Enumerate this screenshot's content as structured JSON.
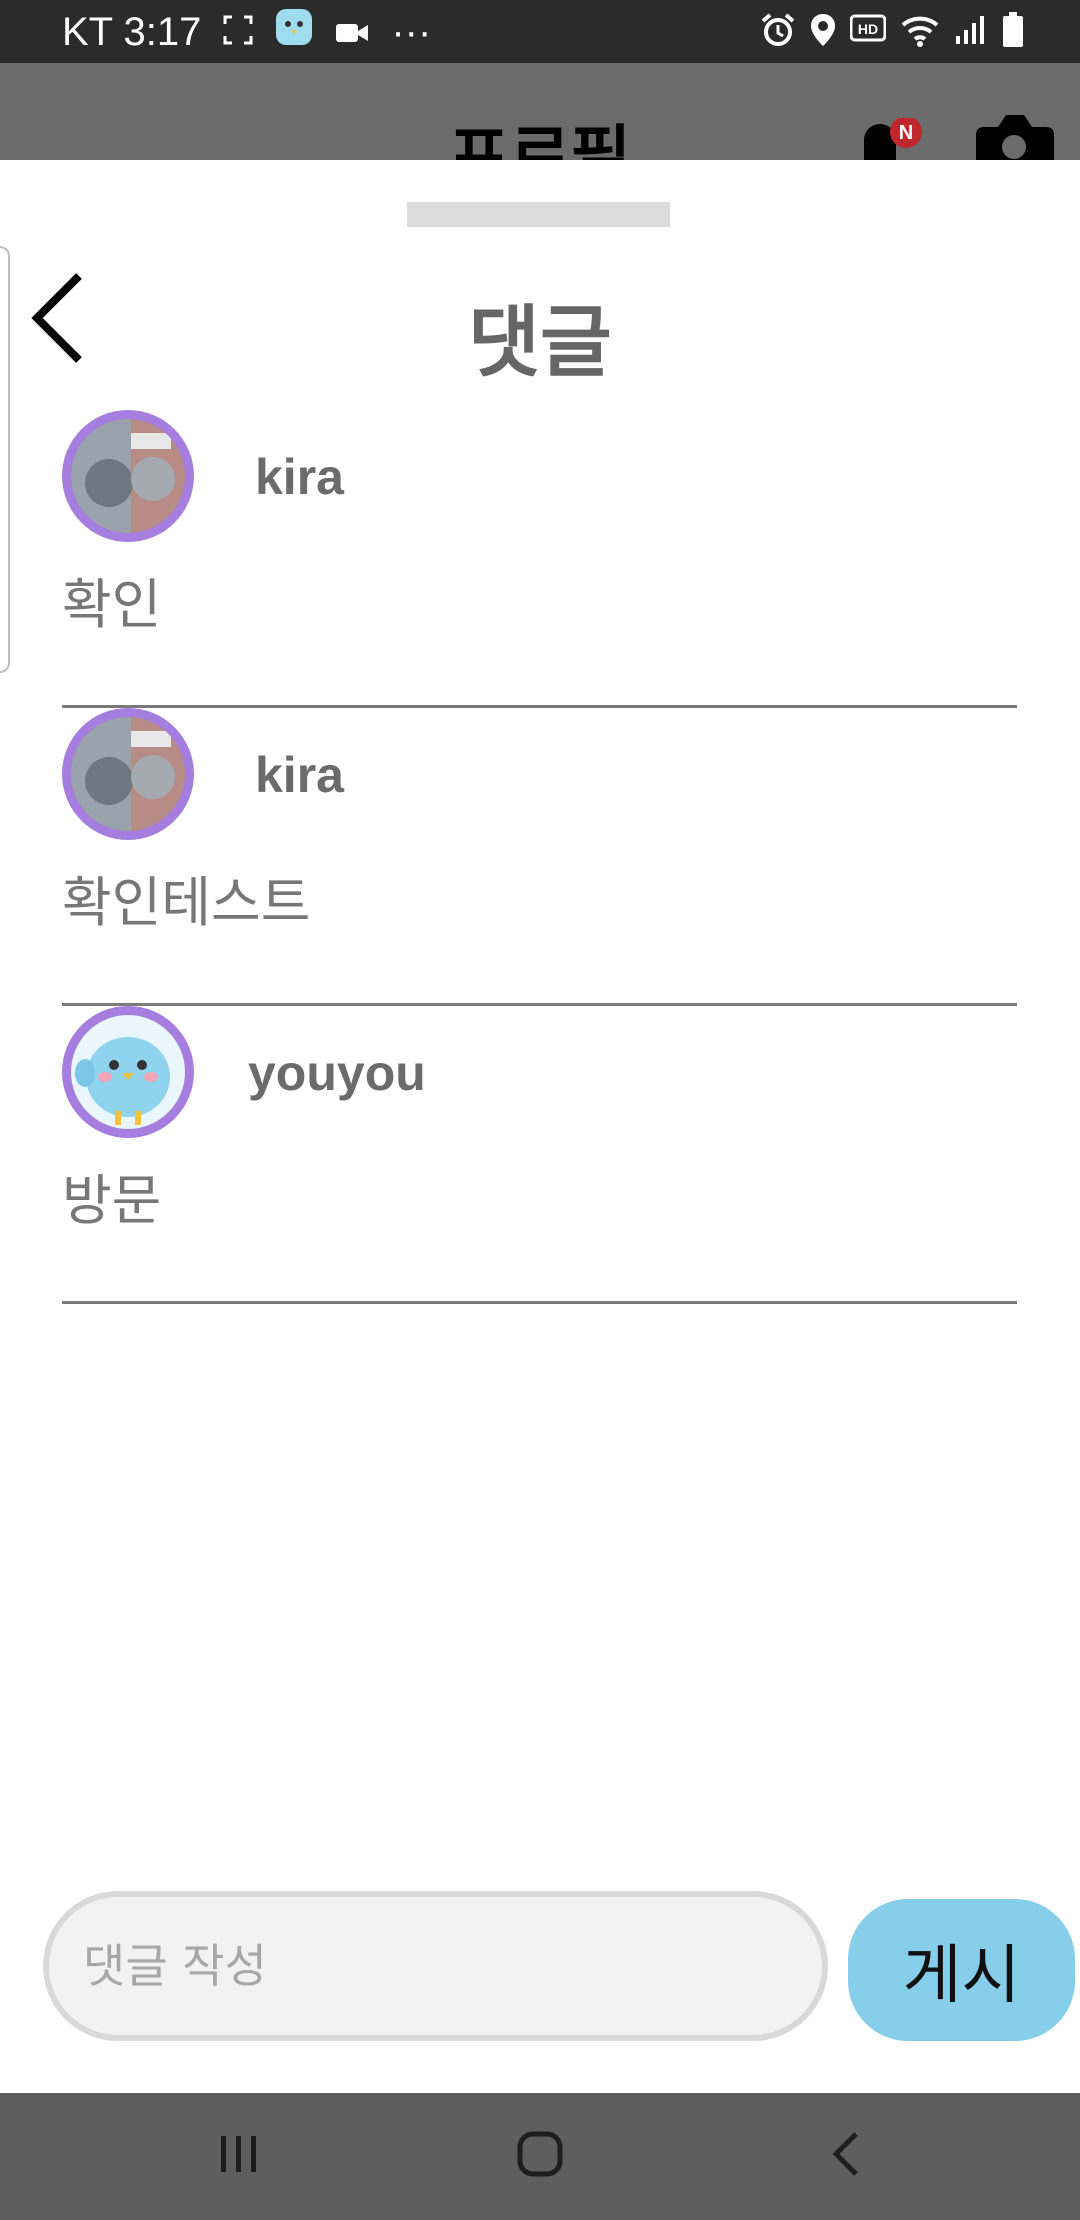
{
  "status_bar": {
    "carrier_time": "KT 3:17",
    "more": "···",
    "hd_label": "HD",
    "icons": [
      "screenshot-icon",
      "app-bird-icon",
      "video-camera-icon",
      "alarm-icon",
      "location-icon",
      "hd-voice-icon",
      "wifi-icon",
      "signal-icon",
      "battery-icon"
    ]
  },
  "background_page": {
    "title": "프로필",
    "notification_badge": "N",
    "icons": [
      "bell-icon",
      "camera-icon"
    ]
  },
  "sheet": {
    "title": "댓글",
    "back_icon": "chevron-left-icon"
  },
  "comments": [
    {
      "username": "kira",
      "text": "확인",
      "avatar": "product-photo-avatar"
    },
    {
      "username": "kira",
      "text": "확인테스트",
      "avatar": "product-photo-avatar"
    },
    {
      "username": "youyou",
      "text": "방문",
      "avatar": "blue-bird-avatar"
    }
  ],
  "composer": {
    "placeholder": "댓글 작성",
    "value": "",
    "post_label": "게시"
  },
  "nav_bar": {
    "icons": [
      "recent-apps-icon",
      "home-icon",
      "back-icon"
    ]
  },
  "colors": {
    "avatar_ring": "#a57ee0",
    "post_button": "#87ceeb",
    "divider": "#7a7a7a",
    "status_bar": "#2b2b2b",
    "nav_bar": "#5e5e5e",
    "badge": "#c0272d"
  }
}
